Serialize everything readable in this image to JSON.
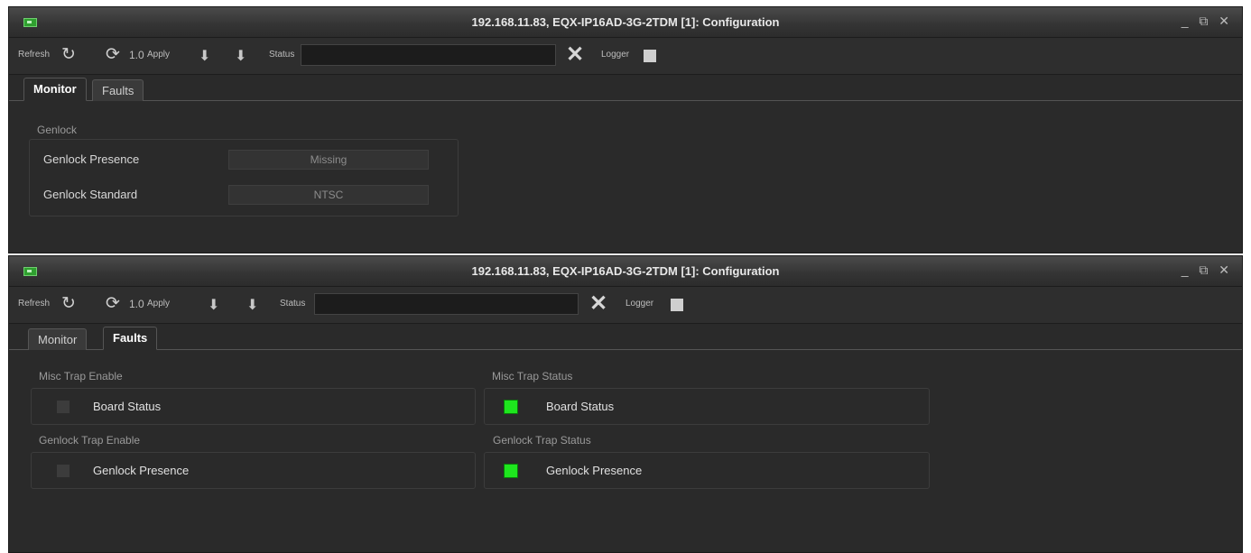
{
  "window1": {
    "title": "192.168.11.83, EQX-IP16AD-3G-2TDM  [1]: Configuration",
    "tabs": [
      {
        "label": "Monitor",
        "active": true
      },
      {
        "label": "Faults",
        "active": false
      }
    ],
    "genlock": {
      "title": "Genlock",
      "rows": [
        {
          "label": "Genlock Presence",
          "value": "Missing"
        },
        {
          "label": "Genlock Standard",
          "value": "NTSC"
        }
      ]
    }
  },
  "window2": {
    "title": "192.168.11.83, EQX-IP16AD-3G-2TDM  [1]: Configuration",
    "tabs": [
      {
        "label": "Monitor",
        "active": false
      },
      {
        "label": "Faults",
        "active": true
      }
    ],
    "misc_trap_enable": {
      "title": "Misc Trap Enable",
      "item": "Board Status",
      "checked": false
    },
    "misc_trap_status": {
      "title": "Misc Trap Status",
      "item": "Board Status",
      "status_color": "#1ee61e"
    },
    "genlock_trap_enable": {
      "title": "Genlock Trap Enable",
      "item": "Genlock Presence",
      "checked": false
    },
    "genlock_trap_status": {
      "title": "Genlock Trap Status",
      "item": "Genlock Presence",
      "status_color": "#1ee61e"
    }
  },
  "toolbar": {
    "refresh_label": "Refresh",
    "version": "1.0",
    "apply_label": "Apply",
    "status_label": "Status",
    "logger_label": "Logger"
  },
  "window_controls": {
    "minimize": "_",
    "restore": "⧉",
    "close": "✕"
  },
  "icons": [
    "app-icon",
    "refresh-icon",
    "reload-icon",
    "download-icon",
    "download-all-icon",
    "clear-icon",
    "logger-toggle"
  ]
}
